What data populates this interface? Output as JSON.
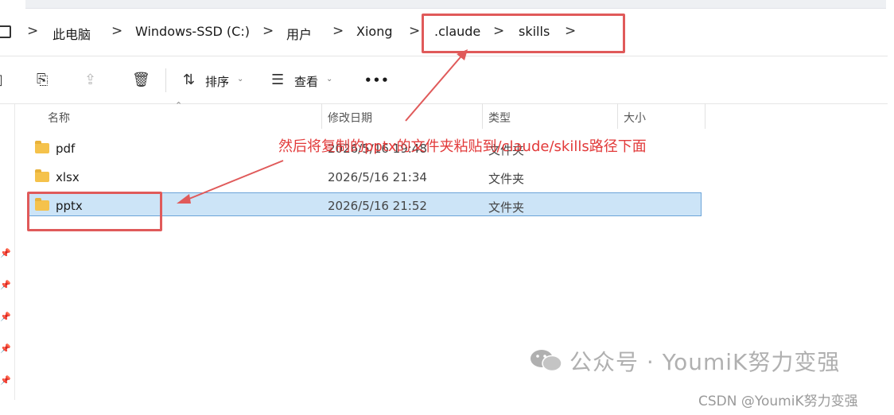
{
  "breadcrumb": {
    "items": [
      "此电脑",
      "Windows-SSD (C:)",
      "用户",
      "Xiong",
      ".claude",
      "skills"
    ],
    "separator": ">"
  },
  "toolbar": {
    "sort_label": "排序",
    "view_label": "查看",
    "more_label": "•••"
  },
  "columns": {
    "name": "名称",
    "modified": "修改日期",
    "type": "类型",
    "size": "大小"
  },
  "files": [
    {
      "name": "pdf",
      "modified": "2026/5/16 19:48",
      "type": "文件夹",
      "selected": false
    },
    {
      "name": "xlsx",
      "modified": "2026/5/16 21:34",
      "type": "文件夹",
      "selected": false
    },
    {
      "name": "pptx",
      "modified": "2026/5/16 21:52",
      "type": "文件夹",
      "selected": true
    }
  ],
  "annotation": {
    "text": "然后将复制的pptx的文件夹粘贴到/claude/skills路径下面",
    "color": "#e23a3a"
  },
  "watermark": {
    "wechat": "公众号 · YoumiK努力变强",
    "csdn": "CSDN @YoumiK努力变强"
  },
  "colors": {
    "selection_bg": "#cce4f7",
    "selection_border": "#6aa3d8",
    "folder": "#f5c24b",
    "highlight_box": "#e05a5a"
  }
}
